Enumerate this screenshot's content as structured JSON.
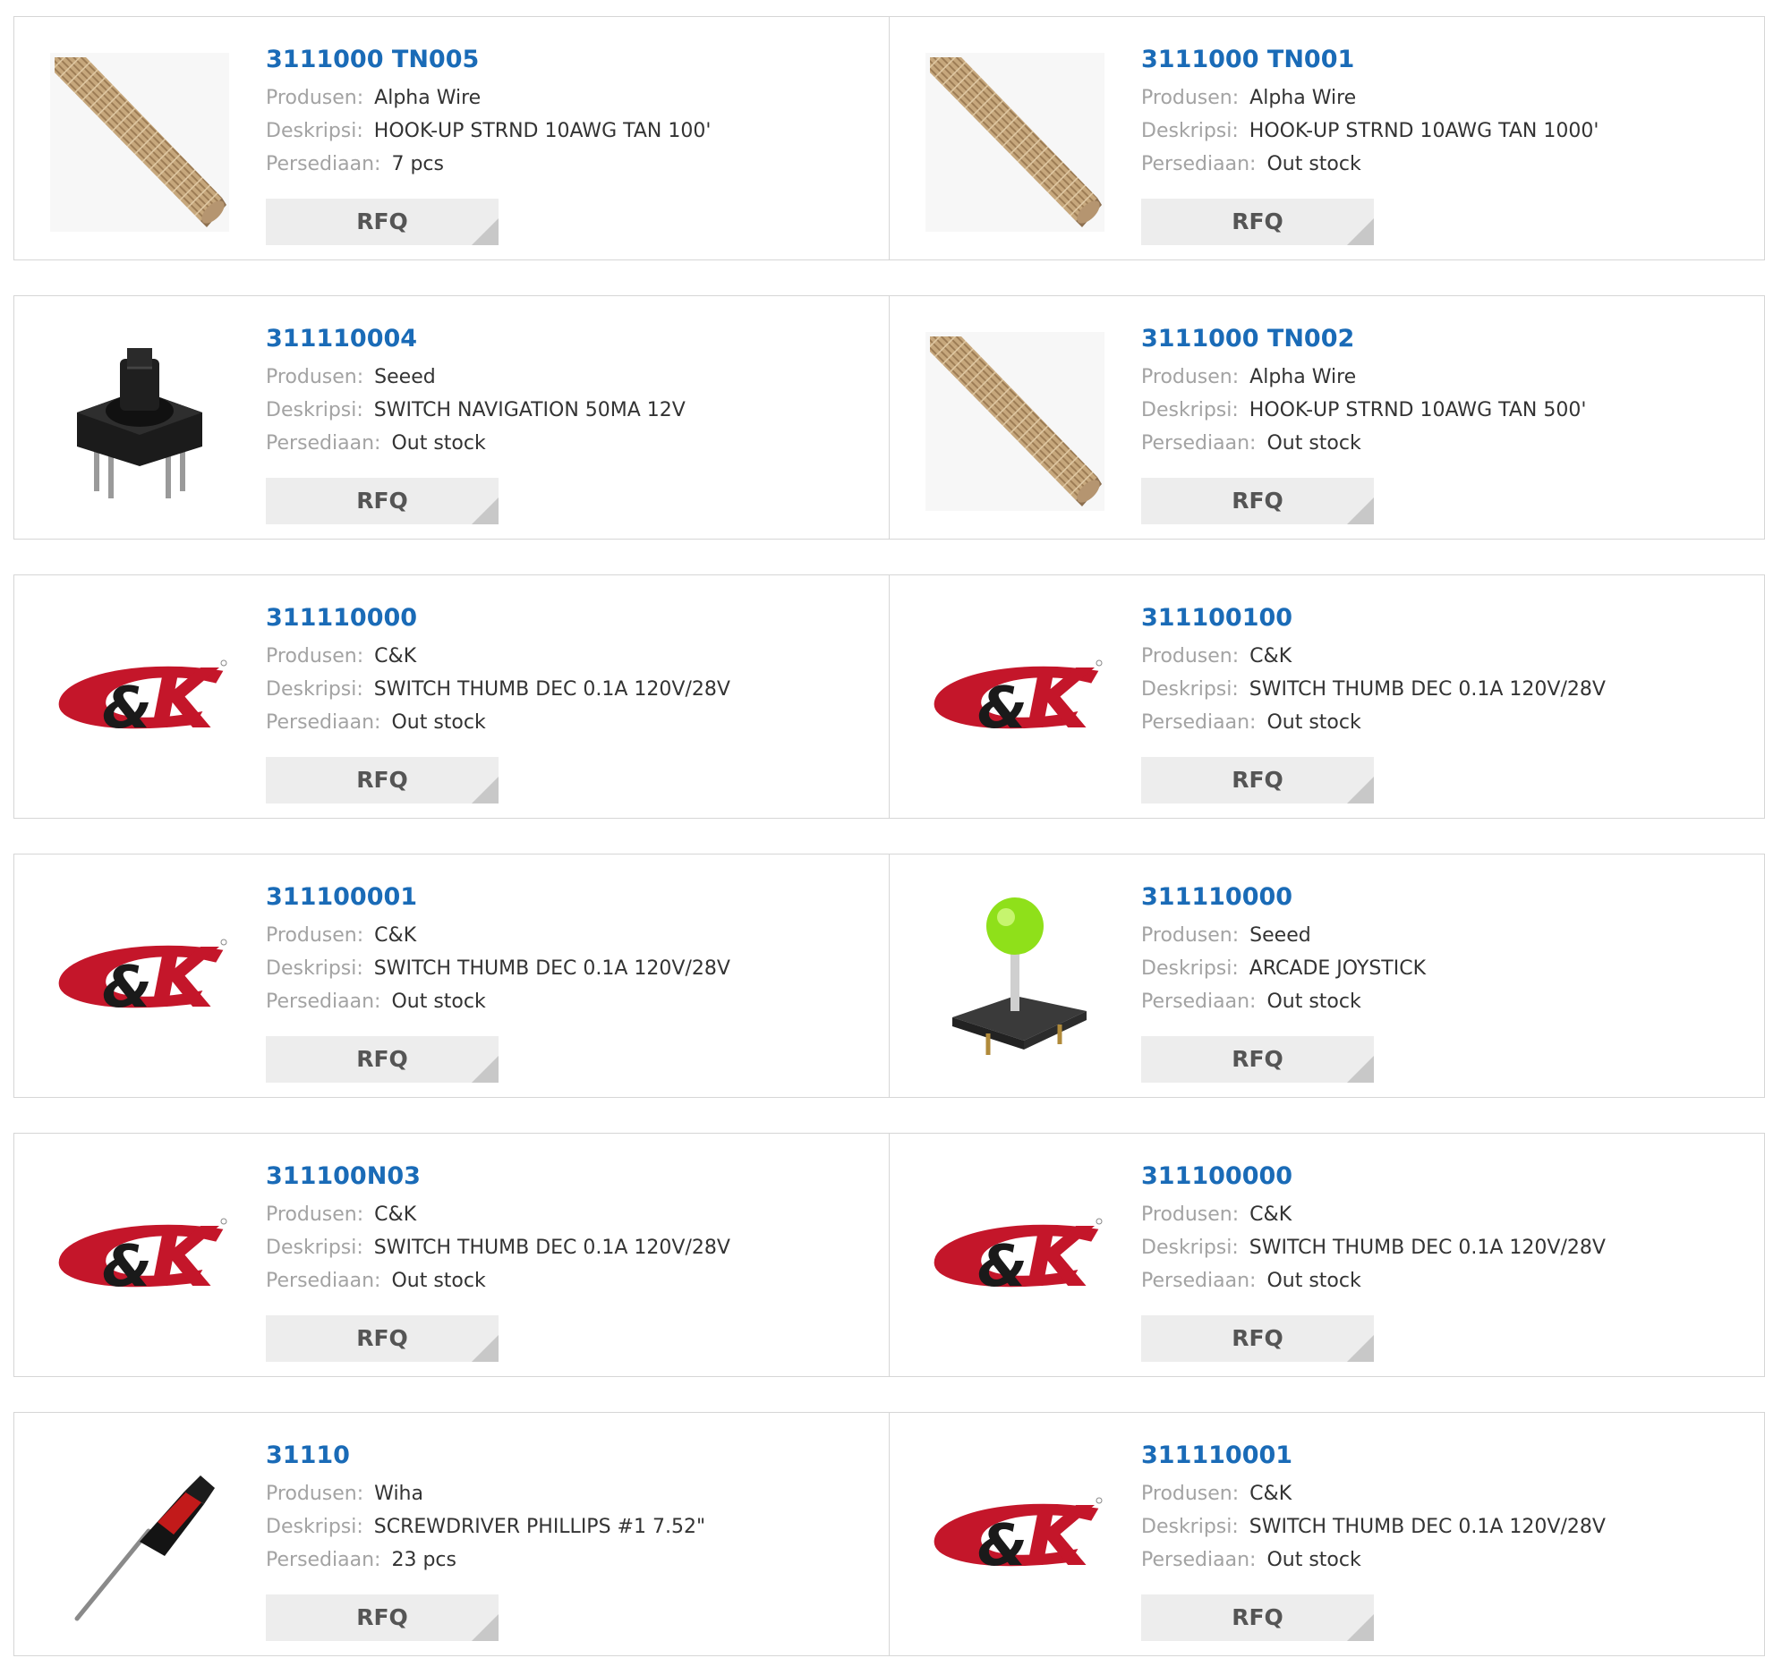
{
  "labels": {
    "produsen": "Produsen:",
    "deskripsi": "Deskripsi:",
    "persediaan": "Persediaan:",
    "rfq": "RFQ"
  },
  "brand": {
    "ck_text": "C&K"
  },
  "colors": {
    "part_link": "#1a6bb7",
    "ck_red": "#c4162a",
    "rfq_bg": "#ededed"
  },
  "products": [
    {
      "part": "3111000 TN005",
      "manufacturer": "Alpha Wire",
      "description": "HOOK-UP STRND 10AWG TAN 100'",
      "stock": "7 pcs",
      "image": "braided-wire"
    },
    {
      "part": "3111000 TN001",
      "manufacturer": "Alpha Wire",
      "description": "HOOK-UP STRND 10AWG TAN 1000'",
      "stock": "Out stock",
      "image": "braided-wire"
    },
    {
      "part": "311110004",
      "manufacturer": "Seeed",
      "description": "SWITCH NAVIGATION 50MA 12V",
      "stock": "Out stock",
      "image": "navigation-switch"
    },
    {
      "part": "3111000 TN002",
      "manufacturer": "Alpha Wire",
      "description": "HOOK-UP STRND 10AWG TAN 500'",
      "stock": "Out stock",
      "image": "braided-wire"
    },
    {
      "part": "311110000",
      "manufacturer": "C&K",
      "description": "SWITCH THUMB DEC 0.1A 120V/28V",
      "stock": "Out stock",
      "image": "ck-logo"
    },
    {
      "part": "311100100",
      "manufacturer": "C&K",
      "description": "SWITCH THUMB DEC 0.1A 120V/28V",
      "stock": "Out stock",
      "image": "ck-logo"
    },
    {
      "part": "311100001",
      "manufacturer": "C&K",
      "description": "SWITCH THUMB DEC 0.1A 120V/28V",
      "stock": "Out stock",
      "image": "ck-logo"
    },
    {
      "part": "311110000",
      "manufacturer": "Seeed",
      "description": "ARCADE JOYSTICK",
      "stock": "Out stock",
      "image": "arcade-joystick"
    },
    {
      "part": "311100N03",
      "manufacturer": "C&K",
      "description": "SWITCH THUMB DEC 0.1A 120V/28V",
      "stock": "Out stock",
      "image": "ck-logo"
    },
    {
      "part": "311100000",
      "manufacturer": "C&K",
      "description": "SWITCH THUMB DEC 0.1A 120V/28V",
      "stock": "Out stock",
      "image": "ck-logo"
    },
    {
      "part": "31110",
      "manufacturer": "Wiha",
      "description": "SCREWDRIVER PHILLIPS #1 7.52\"",
      "stock": "23 pcs",
      "image": "screwdriver"
    },
    {
      "part": "311110001",
      "manufacturer": "C&K",
      "description": "SWITCH THUMB DEC 0.1A 120V/28V",
      "stock": "Out stock",
      "image": "ck-logo"
    }
  ]
}
